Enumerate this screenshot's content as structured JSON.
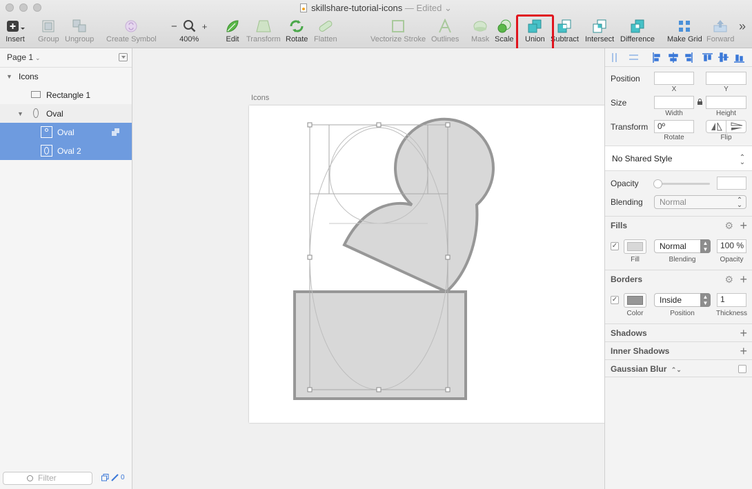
{
  "window": {
    "title": "skillshare-tutorial-icons",
    "edited": "— Edited"
  },
  "toolbar": {
    "insert": "Insert",
    "group": "Group",
    "ungroup": "Ungroup",
    "create_symbol": "Create Symbol",
    "zoom_minus": "−",
    "zoom_plus": "+",
    "zoom_level": "400%",
    "edit": "Edit",
    "transform": "Transform",
    "rotate": "Rotate",
    "flatten": "Flatten",
    "vectorize_stroke": "Vectorize Stroke",
    "outlines": "Outlines",
    "mask": "Mask",
    "scale": "Scale",
    "union": "Union",
    "subtract": "Subtract",
    "intersect": "Intersect",
    "difference": "Difference",
    "make_grid": "Make Grid",
    "forward": "Forward",
    "more": "»"
  },
  "sidebar": {
    "page": "Page 1",
    "layers": [
      {
        "name": "Icons"
      },
      {
        "name": "Rectangle 1"
      },
      {
        "name": "Oval"
      },
      {
        "name": "Oval"
      },
      {
        "name": "Oval 2"
      }
    ],
    "filter_placeholder": "Filter",
    "export_count": "0"
  },
  "canvas": {
    "artboard_name": "Icons"
  },
  "inspector": {
    "position_label": "Position",
    "x_label": "X",
    "y_label": "Y",
    "x_value": "",
    "y_value": "",
    "size_label": "Size",
    "width_label": "Width",
    "height_label": "Height",
    "width_value": "",
    "height_value": "",
    "transform_label": "Transform",
    "rotate_value": "0º",
    "rotate_label": "Rotate",
    "flip_label": "Flip",
    "shared_style": "No Shared Style",
    "opacity_label": "Opacity",
    "opacity_value": "",
    "blending_label": "Blending",
    "blending_value": "Normal",
    "fills": {
      "title": "Fills",
      "enabled": true,
      "color": "#d8d8d8",
      "fill_label": "Fill",
      "blending_value": "Normal",
      "blending_label": "Blending",
      "opacity_value": "100 %",
      "opacity_label": "Opacity"
    },
    "borders": {
      "title": "Borders",
      "enabled": true,
      "color": "#979797",
      "color_label": "Color",
      "position_value": "Inside",
      "position_label": "Position",
      "thickness_value": "1",
      "thickness_label": "Thickness"
    },
    "shadows": "Shadows",
    "inner_shadows": "Inner Shadows",
    "gaussian_blur": "Gaussian Blur"
  },
  "colors": {
    "selection": "#6e9bdf",
    "highlight_box": "#e0141e",
    "shape_fill": "#d8d8d8",
    "shape_stroke": "#979797"
  }
}
